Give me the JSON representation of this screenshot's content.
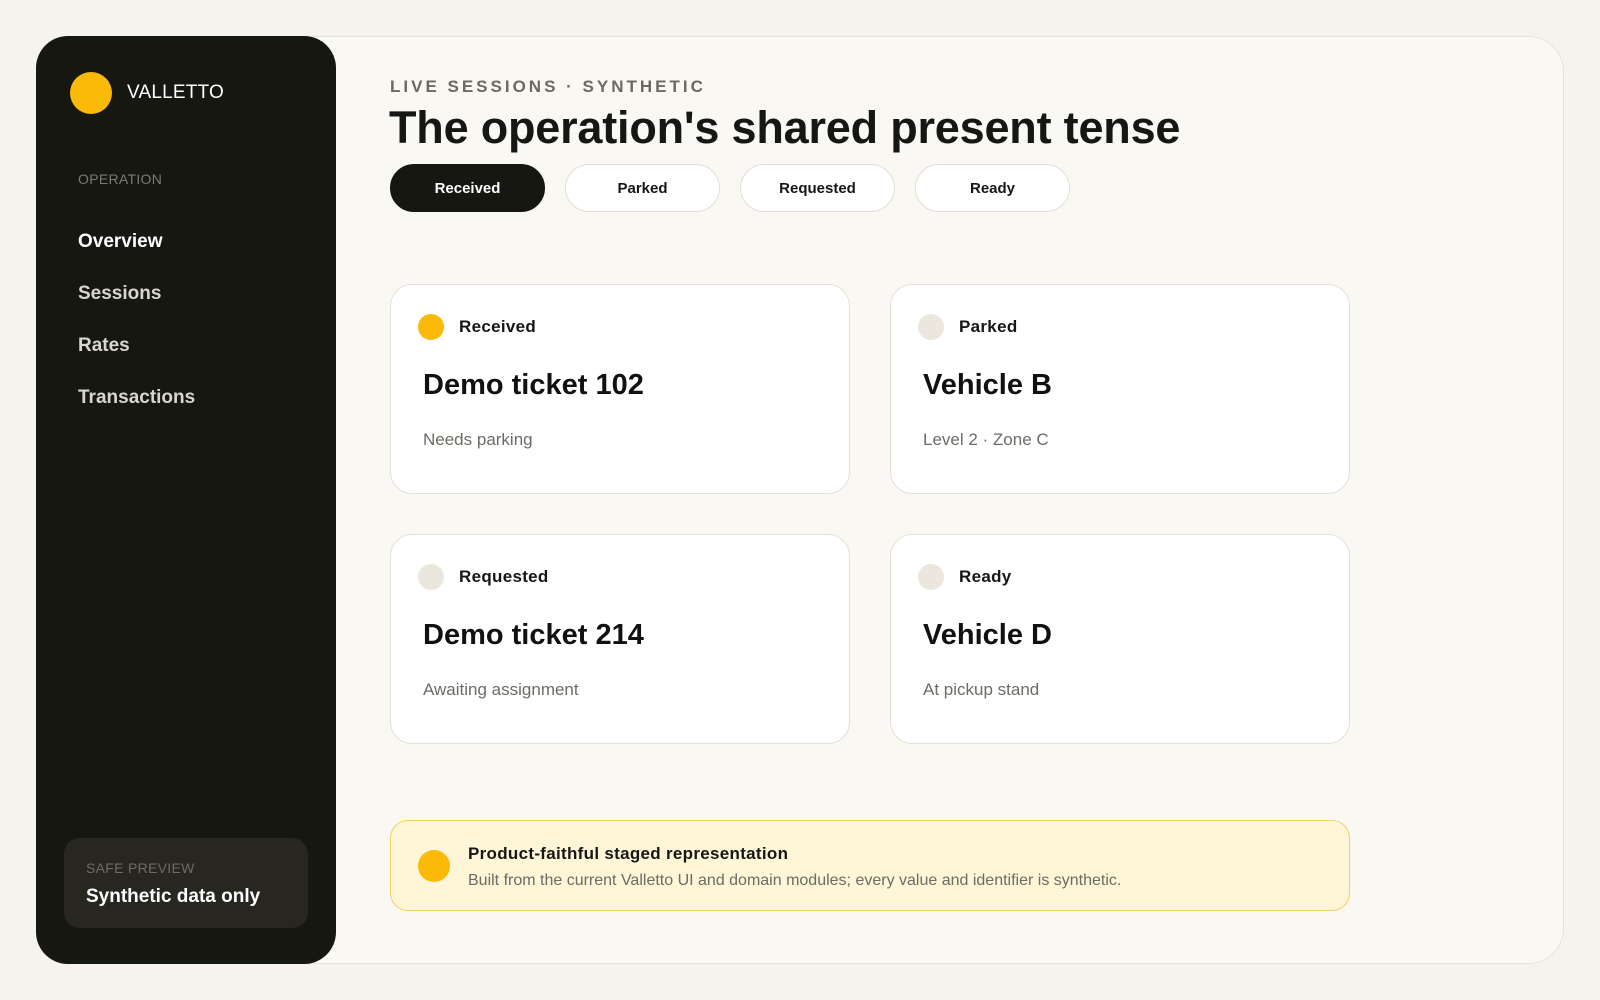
{
  "sidebar": {
    "brand": {
      "name": "VALLETTO",
      "icon": "brand-dot-icon"
    },
    "section_heading": "OPERATION",
    "items": [
      {
        "label": "Overview",
        "active": true
      },
      {
        "label": "Sessions",
        "active": false
      },
      {
        "label": "Rates",
        "active": false
      },
      {
        "label": "Transactions",
        "active": false
      }
    ],
    "preview": {
      "label": "SAFE PREVIEW",
      "text": "Synthetic data only"
    }
  },
  "main": {
    "eyebrow": "LIVE SESSIONS · SYNTHETIC",
    "title": "The operation's shared present tense",
    "tabs": [
      {
        "label": "Received",
        "active": true
      },
      {
        "label": "Parked",
        "active": false
      },
      {
        "label": "Requested",
        "active": false
      },
      {
        "label": "Ready",
        "active": false
      }
    ],
    "cards": [
      {
        "status": "Received",
        "title": "Demo ticket 102",
        "subtitle": "Needs parking",
        "status_active": true
      },
      {
        "status": "Parked",
        "title": "Vehicle B",
        "subtitle": "Level 2 · Zone C",
        "status_active": false
      },
      {
        "status": "Requested",
        "title": "Demo ticket 214",
        "subtitle": "Awaiting assignment",
        "status_active": false
      },
      {
        "status": "Ready",
        "title": "Vehicle D",
        "subtitle": "At pickup stand",
        "status_active": false
      }
    ],
    "notice": {
      "title": "Product-faithful staged representation",
      "text": "Built from the current Valletto UI and domain modules; every value and identifier is synthetic."
    }
  },
  "colors": {
    "accent": "#fbb90a",
    "sidebar_bg": "#171712",
    "page_bg": "#faf8f3",
    "notice_bg": "#fff6d8"
  }
}
